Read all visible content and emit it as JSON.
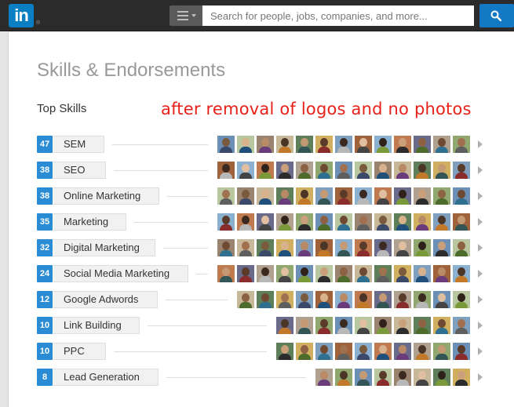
{
  "header": {
    "logo_text": "in",
    "logo_reg": "®",
    "search_placeholder": "Search for people, jobs, companies, and more..."
  },
  "page": {
    "title": "Skills & Endorsements",
    "subtitle": "Top Skills",
    "note": "after removal of logos and no photos"
  },
  "colors": {
    "brand": "#0a7fc4",
    "count_badge": "#2a8cd5",
    "note_text": "#e8201a"
  },
  "skills": [
    {
      "count": "47",
      "name": "SEM",
      "endorsers": 13
    },
    {
      "count": "38",
      "name": "SEO",
      "endorsers": 13
    },
    {
      "count": "38",
      "name": "Online Marketing",
      "endorsers": 13
    },
    {
      "count": "35",
      "name": "Marketing",
      "endorsers": 13
    },
    {
      "count": "32",
      "name": "Digital Marketing",
      "endorsers": 13
    },
    {
      "count": "24",
      "name": "Social Media Marketing",
      "endorsers": 13
    },
    {
      "count": "12",
      "name": "Google Adwords",
      "endorsers": 12
    },
    {
      "count": "10",
      "name": "Link Building",
      "endorsers": 10
    },
    {
      "count": "10",
      "name": "PPC",
      "endorsers": 10
    },
    {
      "count": "8",
      "name": "Lead Generation",
      "endorsers": 8
    }
  ]
}
